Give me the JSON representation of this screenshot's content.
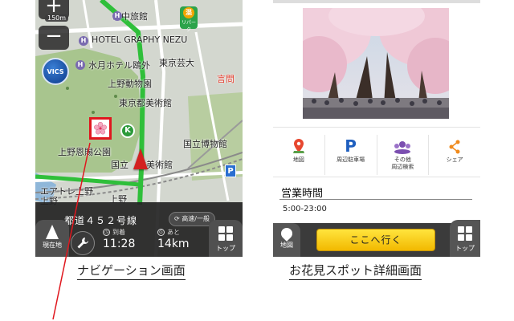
{
  "navigation_screen": {
    "zoom_in_label": "+",
    "zoom_out_label": "−",
    "scale": "150m",
    "vics_label": "VICS",
    "map_labels": {
      "label_yamanaka": "山中旅館",
      "label_hotel": "HOTEL GRAPHY NEZU",
      "label_mizuki": "水月ホテル鴎外",
      "label_tokyo_geidai": "東京芸大",
      "label_zoo": "上野動物園",
      "label_gallery": "東京都美術館",
      "label_park": "上野恩賜公園",
      "label_museum": "国立博物館",
      "label_western": "国立　洋美術館",
      "label_gate": "言問",
      "label_ueno_tl": "上野",
      "label_ueno_road": "上野",
      "label_toaru": "エアトレ上野"
    },
    "poi_k": "K",
    "poi_mixed_top": "混",
    "poi_mixed_bottom": "リパーク",
    "poi_p": "P",
    "road_name": "都道４５２号線",
    "highway_toggle": "高速/一般",
    "current_location_label": "現在地",
    "arrival_caption": "到着",
    "arrival_time": "11:28",
    "remaining_caption": "あと",
    "remaining_distance": "14km",
    "top_label": "トップ",
    "caption": "ナビゲーション画面",
    "colors": {
      "route": "#2fbf3a",
      "park": "#a6c48e",
      "arrow": "#d32020",
      "blossom_frame": "#e0171e"
    }
  },
  "detail_screen": {
    "actions": [
      {
        "icon": "map-pin-icon",
        "label": "地図"
      },
      {
        "icon": "parking-icon",
        "label": "周辺駐車場"
      },
      {
        "icon": "people-search-icon",
        "label": "その他\n周辺検索"
      },
      {
        "icon": "share-icon",
        "label": "シェア"
      }
    ],
    "hours_title": "営業時間",
    "hours_value": "5:00-23:00",
    "map_label": "地図",
    "go_button": "ここへ行く",
    "top_label": "トップ",
    "caption": "お花見スポット詳細画面",
    "colors": {
      "go_button": "#f7cd12"
    }
  }
}
